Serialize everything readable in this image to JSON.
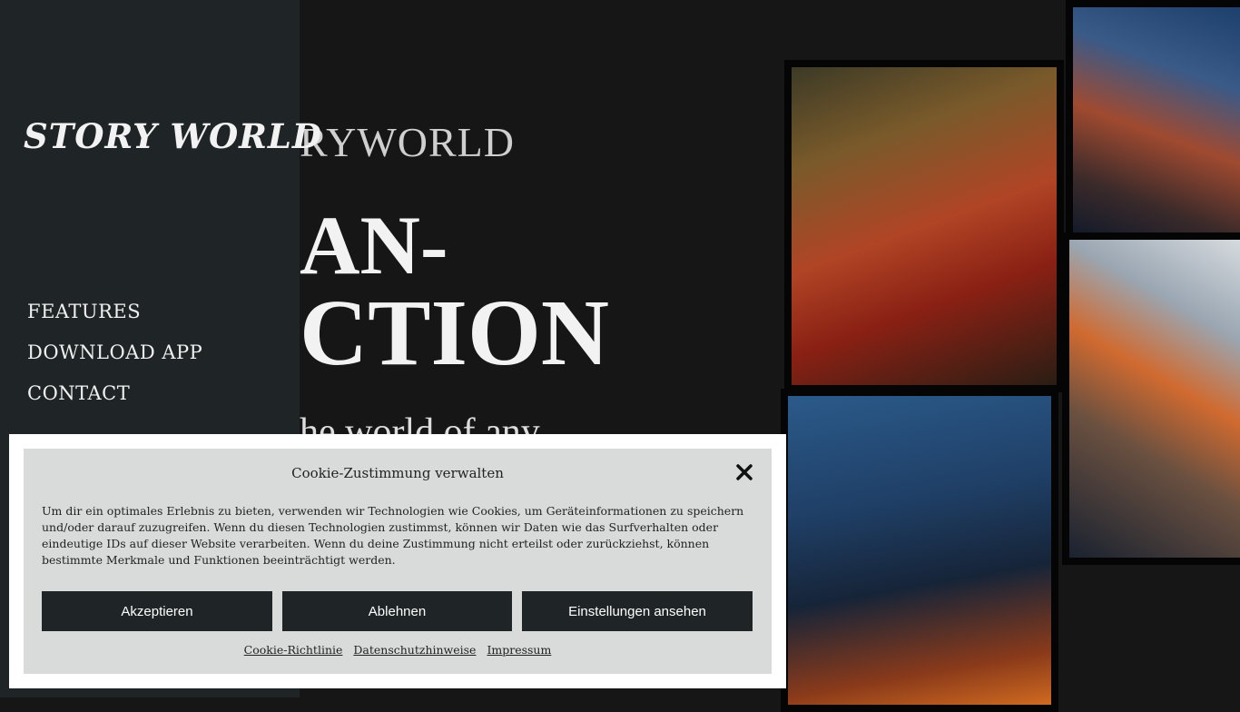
{
  "sidebar": {
    "logo": "STORY WORLD",
    "nav": [
      "FEATURES",
      "DOWNLOAD APP",
      "CONTACT"
    ]
  },
  "hero": {
    "logo_fragment": "RYWORLD",
    "title_line1": "AN-",
    "title_line2": "CTION",
    "subtitle_fragment": "he world of any"
  },
  "cookie": {
    "title": "Cookie-Zustimmung verwalten",
    "text": "Um dir ein optimales Erlebnis zu bieten, verwenden wir Technologien wie Cookies, um Geräteinformationen zu speichern und/oder darauf zuzugreifen. Wenn du diesen Technologien zustimmst, können wir Daten wie das Surfverhalten oder eindeutige IDs auf dieser Website verarbeiten. Wenn du deine Zustimmung nicht erteilst oder zurückziehst, können bestimmte Merkmale und Funktionen beeinträchtigt werden.",
    "accept": "Akzeptieren",
    "decline": "Ablehnen",
    "settings": "Einstellungen ansehen",
    "links": [
      "Cookie-Richtlinie",
      "Datenschutzhinweise",
      "Impressum"
    ]
  }
}
